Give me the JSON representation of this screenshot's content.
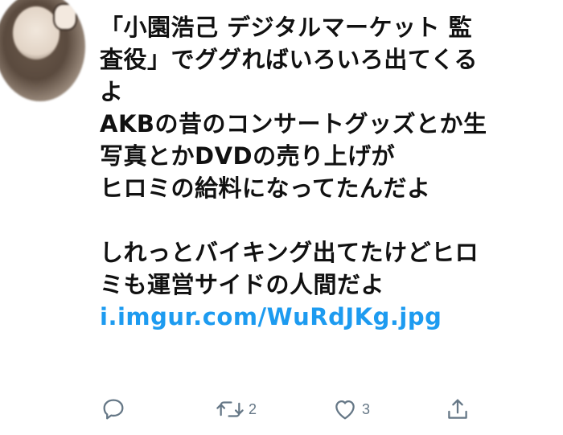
{
  "tweet": {
    "lines": [
      "「小園浩己 デジタルマーケット 監",
      "査役」でググればいろいろ出てくる",
      "よ",
      "AKBの昔のコンサートグッズとか生",
      "写真とかDVDの売り上げが",
      "ヒロミの給料になってたんだよ",
      "",
      "しれっとバイキング出てたけどヒロ",
      "ミも運営サイドの人間だよ"
    ],
    "link": "i.imgur.com/WuRdJKg.jpg"
  },
  "actions": {
    "reply_icon": "reply-icon",
    "retweet_icon": "retweet-icon",
    "retweet_count": "2",
    "like_icon": "heart-icon",
    "like_count": "3",
    "share_icon": "share-icon"
  },
  "colors": {
    "link": "#1d9bf0",
    "action_gray": "#657786",
    "text": "#111111"
  }
}
